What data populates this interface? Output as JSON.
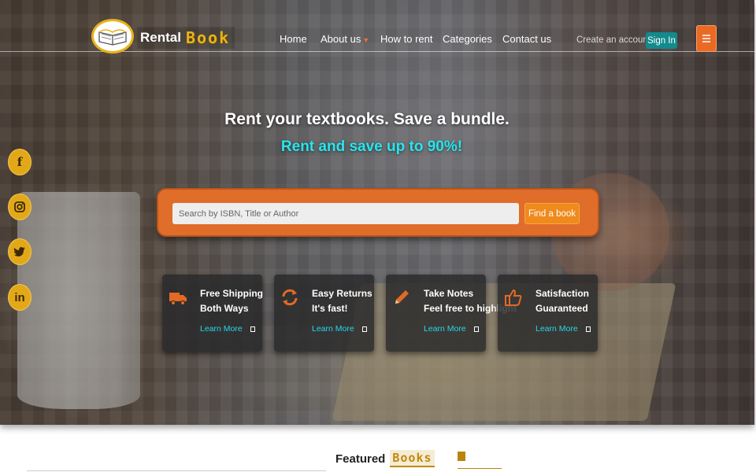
{
  "brand": {
    "word1": "Rental",
    "word2": "Book"
  },
  "nav": {
    "items": [
      {
        "label": "Home",
        "has_caret": false
      },
      {
        "label": "About us",
        "has_caret": true
      },
      {
        "label": "How to rent",
        "has_caret": false
      },
      {
        "label": "Categories",
        "has_caret": false
      },
      {
        "label": "Contact us",
        "has_caret": false
      }
    ],
    "create_account": "Create an account",
    "sign_in": "Sign In",
    "menu_icon": "hamburger-icon"
  },
  "hero": {
    "headline": "Rent your textbooks. Save a bundle.",
    "subheadline": "Rent and save up to 90%!"
  },
  "search": {
    "placeholder": "Search by ISBN, Title or Author",
    "button": "Find a book"
  },
  "features": [
    {
      "icon": "truck-icon",
      "title": "Free Shipping",
      "subtitle": "Both Ways",
      "link": "Learn More"
    },
    {
      "icon": "refresh-icon",
      "title": "Easy Returns",
      "subtitle": "It's fast!",
      "link": "Learn More"
    },
    {
      "icon": "pencil-icon",
      "title": "Take Notes",
      "subtitle": "Feel free to highlight",
      "link": "Learn More"
    },
    {
      "icon": "thumbs-up-icon",
      "title": "Satisfaction",
      "subtitle": "Guaranteed",
      "link": "Learn More"
    }
  ],
  "social": [
    {
      "icon": "facebook-icon",
      "glyph": "f"
    },
    {
      "icon": "instagram-icon",
      "glyph": ""
    },
    {
      "icon": "twitter-icon",
      "glyph": ""
    },
    {
      "icon": "linkedin-icon",
      "glyph": "in"
    }
  ],
  "featured": {
    "label": "Featured",
    "accent": "Books"
  },
  "colors": {
    "accent_orange": "#e06d2a",
    "accent_teal": "#25e6ee",
    "gold": "#e3a818",
    "sign_in_teal": "#138a8c"
  }
}
